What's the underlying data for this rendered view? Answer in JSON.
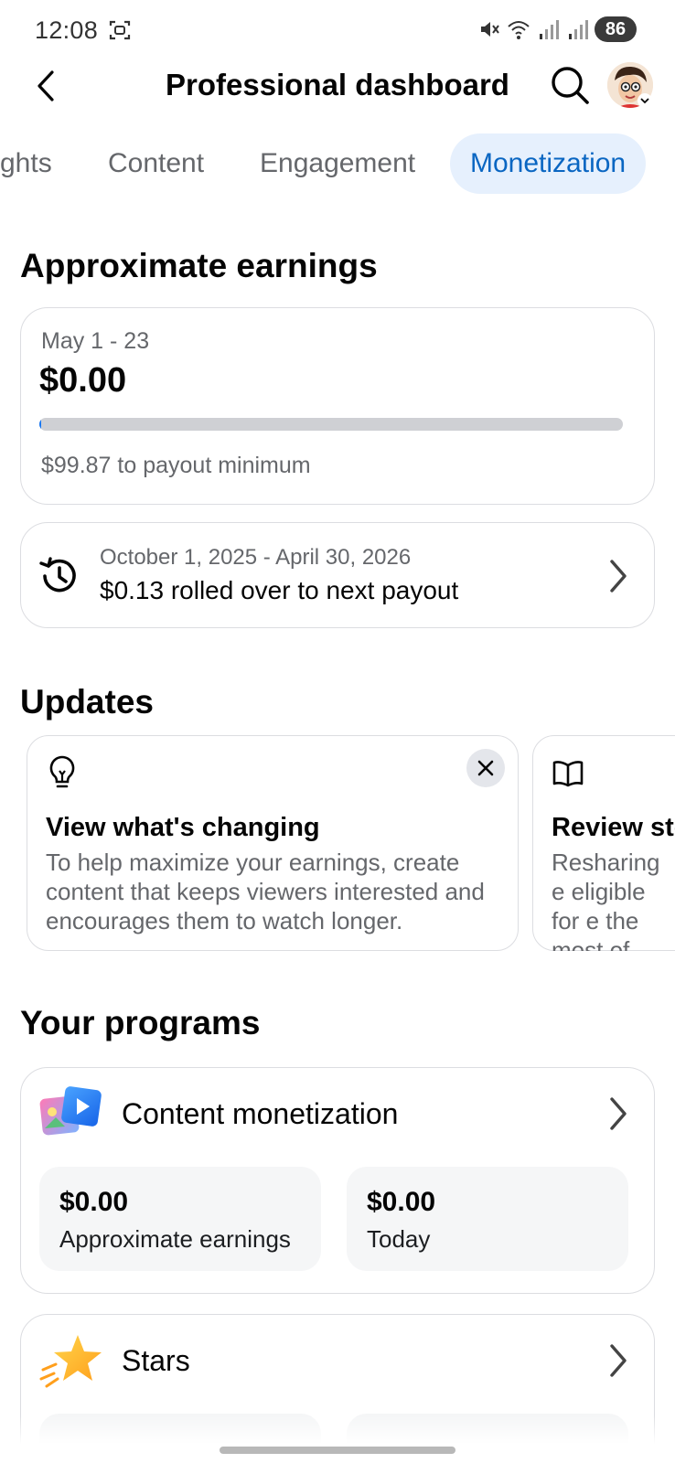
{
  "status_bar": {
    "time": "12:08",
    "battery": "86"
  },
  "header": {
    "title": "Professional dashboard"
  },
  "tabs": [
    {
      "label": "Insights",
      "visible_text": "ghts",
      "active": false
    },
    {
      "label": "Content",
      "active": false
    },
    {
      "label": "Engagement",
      "active": false
    },
    {
      "label": "Monetization",
      "active": true
    }
  ],
  "earnings": {
    "heading": "Approximate earnings",
    "date_range": "May 1 - 23",
    "amount": "$0.00",
    "progress_fraction": 0.002,
    "to_minimum": "$99.87 to payout minimum"
  },
  "rollover": {
    "date_range": "October 1, 2025 - April 30, 2026",
    "text": "$0.13 rolled over to next payout"
  },
  "updates": {
    "heading": "Updates",
    "cards": [
      {
        "icon": "lightbulb-icon",
        "title": "View what's changing",
        "body": "To help maximize your earnings, create content that keeps viewers interested and encourages them to watch longer."
      },
      {
        "icon": "book-icon",
        "title": "Review sto",
        "body": "Resharing e eligible for e the most of"
      }
    ]
  },
  "programs": {
    "heading": "Your programs",
    "items": [
      {
        "name": "Content monetization",
        "icon": "content-monetization-icon",
        "stats": [
          {
            "value": "$0.00",
            "label": "Approximate earnings"
          },
          {
            "value": "$0.00",
            "label": "Today"
          }
        ]
      },
      {
        "name": "Stars",
        "icon": "star-icon"
      }
    ]
  },
  "colors": {
    "accent": "#0a66c2",
    "active_tab_bg": "#e6f0fd",
    "secondary_text": "#65676b",
    "border": "#dcdde1"
  }
}
